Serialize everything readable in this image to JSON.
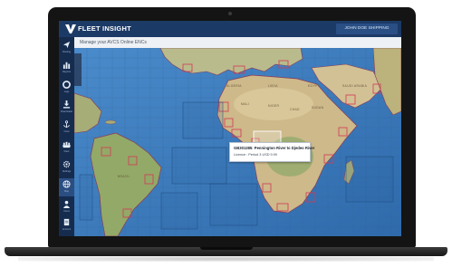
{
  "app": {
    "title": "FLEET INSIGHT",
    "header_button": "JOHN DOE SHIPPING",
    "accent_color": "#1c3a66"
  },
  "subheader": {
    "text": "Manage your AVCS Online ENCs"
  },
  "sidebar": {
    "items": [
      {
        "label": "Routing",
        "icon": "navigation-arrow-icon"
      },
      {
        "label": "Reports",
        "icon": "bar-chart-icon"
      },
      {
        "label": "Logs",
        "icon": "lifebuoy-icon"
      },
      {
        "label": "Downloads",
        "icon": "download-icon"
      },
      {
        "label": "Crew",
        "icon": "anchor-icon"
      },
      {
        "label": "Fleet",
        "icon": "ships-icon"
      },
      {
        "label": "Settings",
        "icon": "gear-icon"
      },
      {
        "label": "Map",
        "icon": "globe-icon",
        "active": true
      },
      {
        "label": "Users",
        "icon": "user-icon"
      },
      {
        "label": "Account",
        "icon": "document-icon"
      }
    ]
  },
  "map": {
    "tooltip": {
      "title": "GB301385: Pennington River to Djedeo River",
      "detail": "Licence : Period 3 USD 9.99"
    },
    "labels": [
      {
        "text": "ALGERIA"
      },
      {
        "text": "LIBYA"
      },
      {
        "text": "EGYPT"
      },
      {
        "text": "MALI"
      },
      {
        "text": "NIGER"
      },
      {
        "text": "CHAD"
      },
      {
        "text": "SUDAN"
      },
      {
        "text": "BRAZIL"
      },
      {
        "text": "SAUDI ARABIA"
      }
    ],
    "colors": {
      "ocean": "#3f7fc0",
      "land": "#c9b98f",
      "cell_border": "#2f5d8f",
      "cell_highlight": "#d33a55"
    }
  }
}
